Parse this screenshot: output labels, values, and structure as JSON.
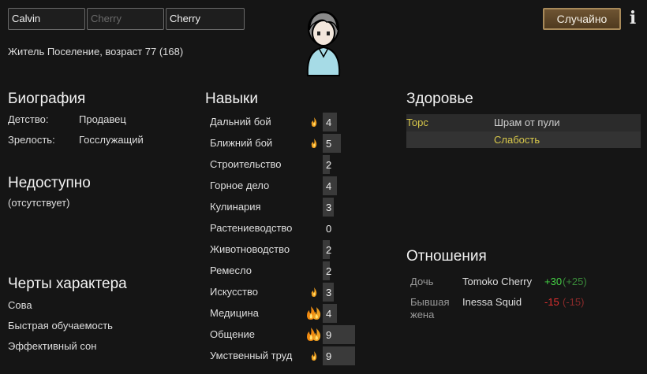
{
  "header": {
    "first_name": "Calvin",
    "nick_name_placeholder": "Cherry",
    "last_name": "Cherry",
    "subtitle": "Житель Поселение, возраст 77 (168)",
    "random_button": "Случайно",
    "info_icon": "info-icon"
  },
  "biography": {
    "title": "Биография",
    "rows": [
      {
        "label": "Детство:",
        "value": "Продавец"
      },
      {
        "label": "Зрелость:",
        "value": "Госслужащий"
      }
    ]
  },
  "incapable": {
    "title": "Недоступно",
    "value": "(отсутствует)"
  },
  "traits": {
    "title": "Черты характера",
    "items": [
      "Сова",
      "Быстрая обучаемость",
      "Эффективный сон"
    ]
  },
  "skills": {
    "title": "Навыки",
    "items": [
      {
        "name": "Дальний бой",
        "level": 4,
        "passion": "minor"
      },
      {
        "name": "Ближний бой",
        "level": 5,
        "passion": "minor"
      },
      {
        "name": "Строительство",
        "level": 2,
        "passion": "none"
      },
      {
        "name": "Горное дело",
        "level": 4,
        "passion": "none"
      },
      {
        "name": "Кулинария",
        "level": 3,
        "passion": "none"
      },
      {
        "name": "Растениеводство",
        "level": 0,
        "passion": "none"
      },
      {
        "name": "Животноводство",
        "level": 2,
        "passion": "none"
      },
      {
        "name": "Ремесло",
        "level": 2,
        "passion": "none"
      },
      {
        "name": "Искусство",
        "level": 3,
        "passion": "minor"
      },
      {
        "name": "Медицина",
        "level": 4,
        "passion": "major"
      },
      {
        "name": "Общение",
        "level": 9,
        "passion": "major"
      },
      {
        "name": "Умственный труд",
        "level": 9,
        "passion": "minor"
      }
    ]
  },
  "health": {
    "title": "Здоровье",
    "part": "Торс",
    "conditions": [
      "Шрам от пули",
      "Слабость"
    ]
  },
  "relations": {
    "title": "Отношения",
    "items": [
      {
        "relation": "Дочь",
        "name": "Tomoko Cherry",
        "opinion": "+30",
        "their_opinion": "(+25)"
      },
      {
        "relation": "Бывшая жена",
        "name": "Inessa Squid",
        "opinion": "-15",
        "their_opinion": "(-15)"
      }
    ]
  },
  "colors": {
    "health_part": "#d8c84a",
    "weakness": "#d8c84a",
    "positive": "#44d044",
    "positive_dim": "#3a8a3a",
    "negative": "#e03030",
    "negative_dim": "#8a2a2a",
    "button": "#5e4728"
  }
}
